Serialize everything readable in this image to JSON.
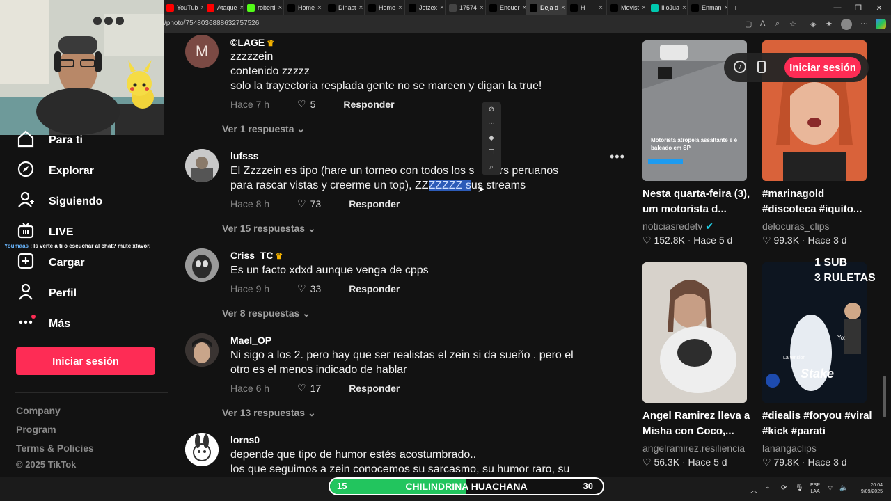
{
  "browser": {
    "tabs": [
      {
        "label": "YouTub",
        "favicon": "youtube-icon",
        "color": "#ff0000"
      },
      {
        "label": "Ataque",
        "favicon": "youtube-icon",
        "color": "#ff0000"
      },
      {
        "label": "roberti",
        "favicon": "kick-icon",
        "color": "#53fc18"
      },
      {
        "label": "Home",
        "favicon": "x-icon",
        "color": "#000000"
      },
      {
        "label": "Dinast",
        "favicon": "x-icon",
        "color": "#000000"
      },
      {
        "label": "Home",
        "favicon": "x-icon",
        "color": "#000000"
      },
      {
        "label": "Jefzex",
        "favicon": "x-icon",
        "color": "#000000"
      },
      {
        "label": "17574",
        "favicon": "globe-icon",
        "color": "#444444"
      },
      {
        "label": "Encuer",
        "favicon": "tiktok-icon",
        "color": "#000000"
      },
      {
        "label": "Deja d",
        "favicon": "tiktok-icon",
        "color": "#000000"
      },
      {
        "label": "H",
        "favicon": "x-icon",
        "color": "#000000"
      },
      {
        "label": "Movist",
        "favicon": "x-icon",
        "color": "#000000"
      },
      {
        "label": "IlloJua",
        "favicon": "twitch-icon",
        "color": "#00c8af"
      },
      {
        "label": "Enman",
        "favicon": "x-icon",
        "color": "#000000"
      }
    ],
    "url": "/photo/7548036888632757526"
  },
  "sidebar": {
    "items": [
      {
        "label": "Para ti",
        "icon": "home-icon"
      },
      {
        "label": "Explorar",
        "icon": "compass-icon"
      },
      {
        "label": "Siguiendo",
        "icon": "user-plus-icon"
      },
      {
        "label": "LIVE",
        "icon": "live-tv-icon"
      },
      {
        "label": "Cargar",
        "icon": "plus-square-icon"
      },
      {
        "label": "Perfil",
        "icon": "person-icon"
      },
      {
        "label": "Más",
        "icon": "more-dots-icon"
      }
    ],
    "login_label": "Iniciar sesión",
    "footer": [
      "Company",
      "Program",
      "Terms & Policies"
    ],
    "copyright": "© 2025 TikTok"
  },
  "stream_chat": {
    "user": "Youmaas",
    "message": " : Is verte a ti o escuchar al chat? mute xfavor."
  },
  "comments": [
    {
      "user": "©LAGE",
      "crown": true,
      "lines": [
        "zzzzzein",
        "contenido zzzzz",
        "solo la trayectoria resplada gente no se mareen y digan la true!"
      ],
      "time": "Hace 7 h",
      "likes": "5",
      "reply": "Responder",
      "more": "Ver 1 respuesta"
    },
    {
      "user": "lufsss",
      "crown": false,
      "text_a": "El Zzzzein es tipo (hare un torneo con todos los s",
      "text_b": "mers peruanos",
      "text_c": "para rascar vistas y creerme un top), ZZ",
      "text_sel": "ZZZZZ s",
      "text_d": "us streams",
      "time": "Hace 8 h",
      "likes": "73",
      "reply": "Responder",
      "more": "Ver 15 respuestas"
    },
    {
      "user": "Criss_TC",
      "crown": true,
      "lines": [
        "Es un facto xdxd aunque venga de cpps"
      ],
      "time": "Hace 9 h",
      "likes": "33",
      "reply": "Responder",
      "more": "Ver 8 respuestas"
    },
    {
      "user": "Mael_OP",
      "crown": false,
      "lines": [
        "Ni sigo a los 2. pero hay que ser realistas el zein si da sueño . pero el",
        "otro es el menos indicado de hablar"
      ],
      "time": "Hace 6 h",
      "likes": "17",
      "reply": "Responder",
      "more": "Ver 13 respuestas"
    },
    {
      "user": "lorns0",
      "crown": false,
      "lines": [
        "depende que tipo de humor estés acostumbrado..",
        "los que seguimos a zein conocemos su sarcasmo, su humor raro, su"
      ]
    }
  ],
  "cards": [
    {
      "title": "Nesta quarta-feira (3), um motorista d...",
      "author": "noticiasredetv",
      "verified": true,
      "views": "152.8K",
      "age": "Hace 5 d",
      "thumb_caption": "Motorista atropela assaltante e é baleado em SP"
    },
    {
      "title": "#marinagold #discoteca #iquito...",
      "author": "delocuras_clips",
      "verified": false,
      "views": "99.3K",
      "age": "Hace 3 d"
    },
    {
      "title": "Angel Ramirez lleva a Misha con Coco,...",
      "author": "angelramirez.resiliencia",
      "verified": false,
      "views": "56.3K",
      "age": "Hace 5 d"
    },
    {
      "title": "#diealis #foryou #viral #kick #parati",
      "author": "lanangaclips",
      "verified": false,
      "views": "79.8K",
      "age": "Hace 3 d",
      "thumb_text_a": "La tension",
      "thumb_text_b": "Yo:",
      "thumb_logo": "Stake"
    }
  ],
  "top_right": {
    "login_label": "Iniciar sesión"
  },
  "overlay": {
    "line1": "1 SUB",
    "line2": "3 RULETAS"
  },
  "goal_bar": {
    "left": "15",
    "title": "CHILINDRINA HUACHANA",
    "right": "30",
    "progress_fraction": 0.5
  },
  "taskbar": {
    "lang1": "ESP",
    "lang2": "LAA",
    "time": "20:04",
    "date": "9/09/2025"
  },
  "colors": {
    "accent": "#fe2c55",
    "goal_green": "#22c55e",
    "crown": "#f5b300"
  }
}
